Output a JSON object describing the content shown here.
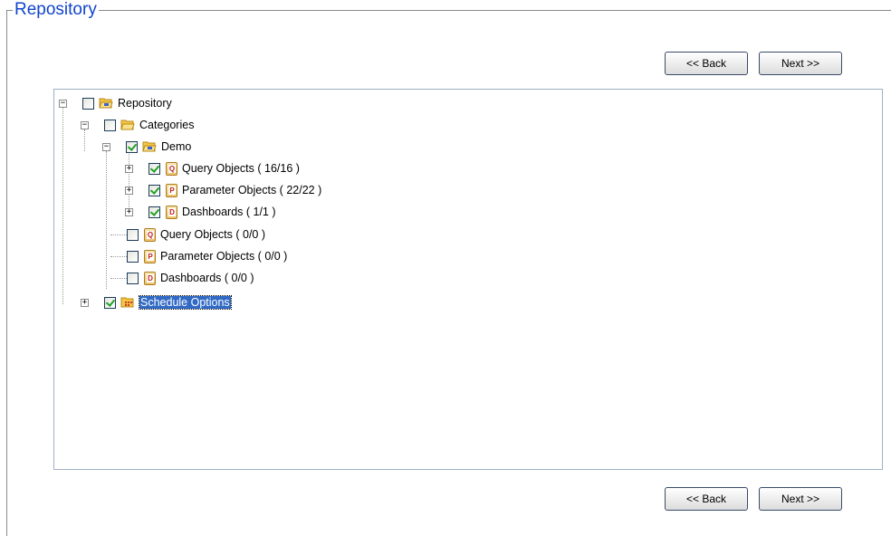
{
  "section": {
    "title": "Repository"
  },
  "nav_top": {
    "back_label": "<< Back",
    "next_label": "Next >>"
  },
  "nav_bottom": {
    "back_label": "<< Back",
    "next_label": "Next >>"
  },
  "tree": {
    "root": {
      "label": "Repository",
      "checked": false
    },
    "categories": {
      "label": "Categories",
      "checked": false
    },
    "demo": {
      "label": "Demo",
      "checked": true
    },
    "demo_query": {
      "label": "Query Objects ( 16/16 )",
      "checked": true,
      "icon_letter": "Q"
    },
    "demo_param": {
      "label": "Parameter Objects ( 22/22 )",
      "checked": true,
      "icon_letter": "P"
    },
    "demo_dash": {
      "label": "Dashboards ( 1/1 )",
      "checked": true,
      "icon_letter": "D"
    },
    "query": {
      "label": "Query Objects ( 0/0 )",
      "checked": false,
      "icon_letter": "Q"
    },
    "param": {
      "label": "Parameter Objects ( 0/0 )",
      "checked": false,
      "icon_letter": "P"
    },
    "dash": {
      "label": "Dashboards ( 0/0 )",
      "checked": false,
      "icon_letter": "D"
    },
    "schedule": {
      "label": "Schedule Options",
      "checked": true,
      "selected": true
    }
  }
}
